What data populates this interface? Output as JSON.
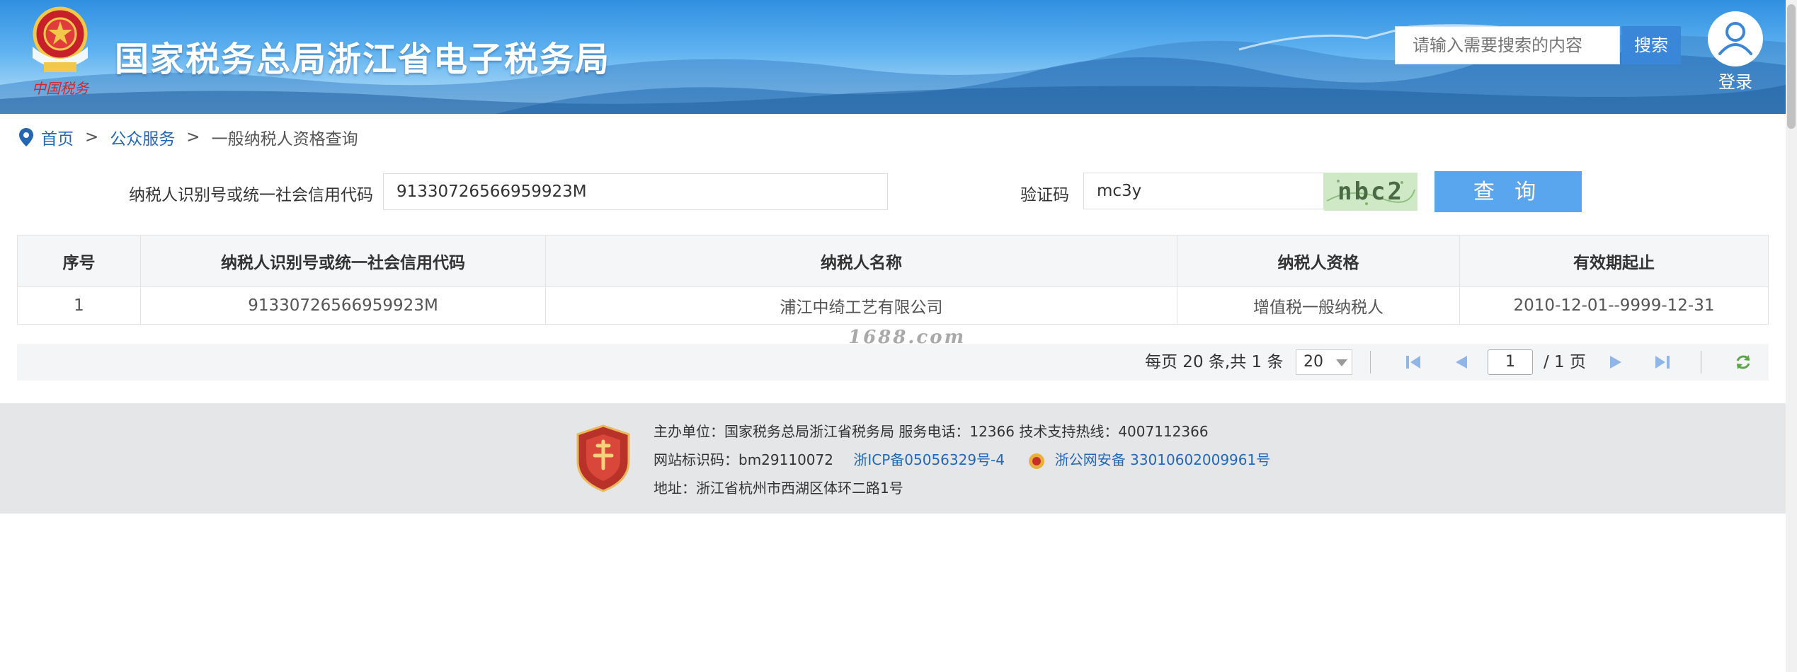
{
  "header": {
    "title": "国家税务总局浙江省电子税务局",
    "search_placeholder": "请输入需要搜索的内容",
    "search_button": "搜索",
    "login_label": "登录"
  },
  "breadcrumb": {
    "items": [
      "首页",
      "公众服务"
    ],
    "separator": ">",
    "current": "一般纳税人资格查询"
  },
  "form": {
    "taxpayer_id_label": "纳税人识别号或统一社会信用代码",
    "taxpayer_id_value": "91330726566959923M",
    "captcha_label": "验证码",
    "captcha_value": "mc3y",
    "captcha_image_text": "nbc2",
    "query_button": "查 询"
  },
  "table": {
    "headers": [
      "序号",
      "纳税人识别号或统一社会信用代码",
      "纳税人名称",
      "纳税人资格",
      "有效期起止"
    ],
    "rows": [
      [
        "1",
        "91330726566959923M",
        "浦江中绮工艺有限公司",
        "增值税一般纳税人",
        "2010-12-01--9999-12-31"
      ]
    ]
  },
  "watermark": "1688.com",
  "pagination": {
    "info": "每页 20 条,共 1 条",
    "page_size": "20",
    "current_page": "1",
    "total_pages": "/ 1 页"
  },
  "footer": {
    "sponsor": "主办单位：国家税务总局浙江省税务局     服务电话：12366     技术支持热线：4007112366",
    "site_id": "网站标识码：bm29110072",
    "icp": "浙ICP备05056329号-4",
    "police": "浙公网安备 33010602009961号",
    "address": "地址：浙江省杭州市西湖区体环二路1号"
  },
  "colors": {
    "accent": "#3a86d9",
    "query_button": "#5aa6ee",
    "link": "#2468b4"
  }
}
